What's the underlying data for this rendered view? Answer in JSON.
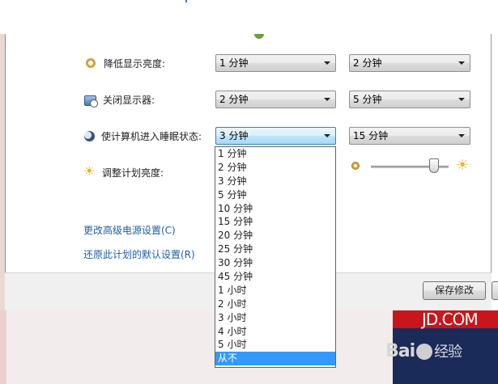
{
  "settings": {
    "dim_display": {
      "label": "降低显示亮度:",
      "battery": "1 分钟",
      "plugged": "2 分钟"
    },
    "turn_off_display": {
      "label": "关闭显示器:",
      "battery": "2 分钟",
      "plugged": "5 分钟"
    },
    "sleep": {
      "label": "使计算机进入睡眠状态:",
      "battery": "3 分钟",
      "plugged": "15 分钟"
    },
    "brightness": {
      "label": "调整计划亮度:",
      "plugged_level_fraction": 0.85
    }
  },
  "dropdown": {
    "options": [
      "1 分钟",
      "2 分钟",
      "3 分钟",
      "5 分钟",
      "10 分钟",
      "15 分钟",
      "20 分钟",
      "25 分钟",
      "30 分钟",
      "45 分钟",
      "1 小时",
      "2 小时",
      "3 小时",
      "4 小时",
      "5 小时",
      "从不"
    ],
    "highlighted": "从不"
  },
  "links": {
    "advanced": "更改高级电源设置(C)",
    "restore": "还原此计划的默认设置(R)"
  },
  "footer": {
    "save_label": "保存修改"
  },
  "background": {
    "banner_text": "JD.COM",
    "watermark": "Bai",
    "watermark_cn": "经验"
  }
}
